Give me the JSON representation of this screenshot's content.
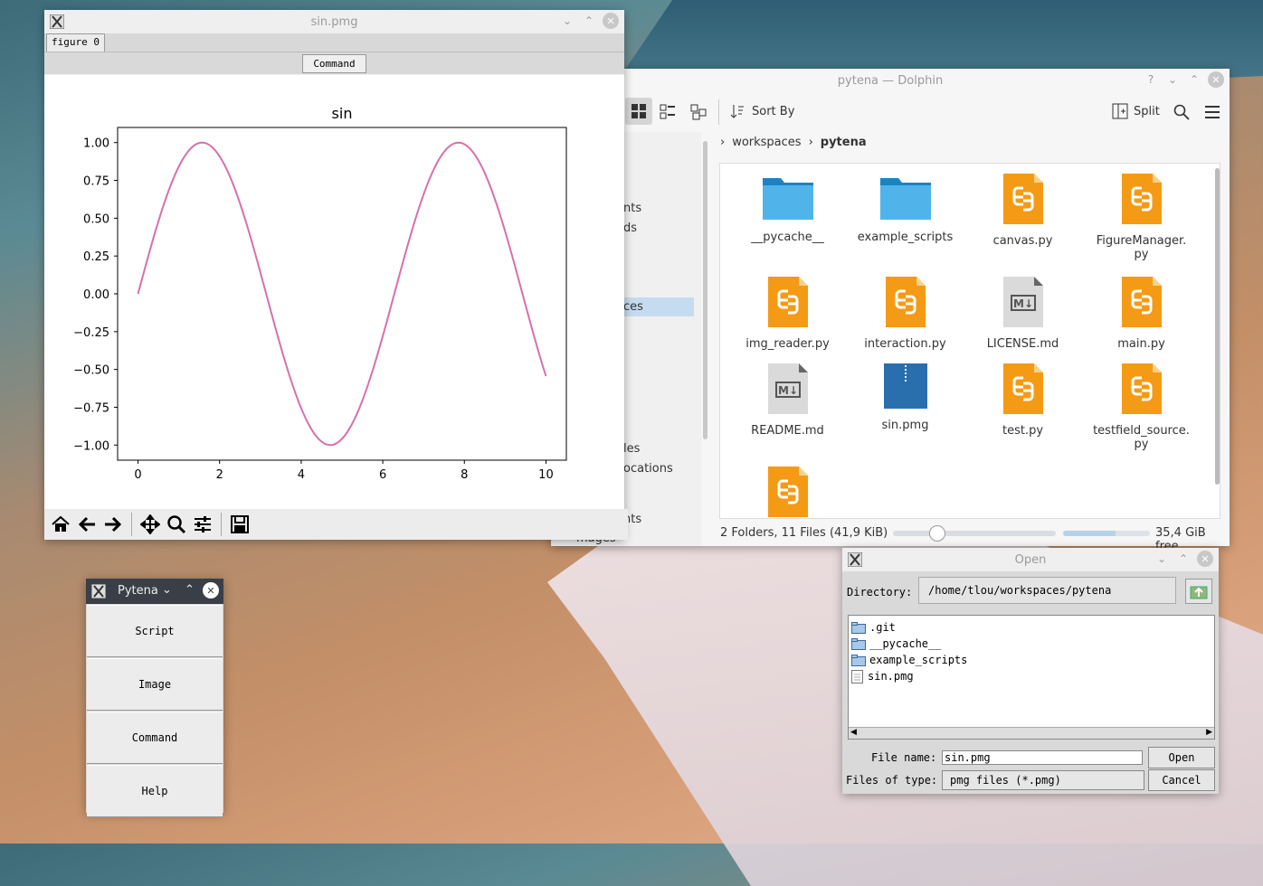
{
  "sin_window": {
    "title": "sin.pmg",
    "figure_tab": "figure 0",
    "command_button": "Command"
  },
  "chart_data": {
    "type": "line",
    "title": "sin",
    "xlabel": "",
    "ylabel": "",
    "xlim": [
      -0.5,
      10.5
    ],
    "ylim": [
      -1.1,
      1.1
    ],
    "x_ticks": [
      0,
      2,
      4,
      6,
      8,
      10
    ],
    "y_ticks": [
      1.0,
      0.75,
      0.5,
      0.25,
      0.0,
      -0.25,
      -0.5,
      -0.75,
      -1.0
    ],
    "x_tick_labels": [
      "0",
      "2",
      "4",
      "6",
      "8",
      "10"
    ],
    "y_tick_labels": [
      "1.00",
      "0.75",
      "0.50",
      "0.25",
      "0.00",
      "−0.25",
      "−0.50",
      "−0.75",
      "−1.00"
    ],
    "series": [
      {
        "function": "sin(x)",
        "x_range": [
          0,
          10
        ],
        "color": "#d670ad"
      }
    ],
    "grid": false
  },
  "dolphin": {
    "title": "pytena — Dolphin",
    "sort_label": "Sort By",
    "split_label": "Split",
    "breadcrumb": [
      "workspaces",
      "pytena"
    ],
    "sidebar_fragments": [
      "nts",
      "ds",
      "ces",
      "les",
      "ocations",
      "nts",
      "mages"
    ],
    "files": [
      {
        "name": "__pycache__",
        "kind": "folder"
      },
      {
        "name": "example_scripts",
        "kind": "folder"
      },
      {
        "name": "canvas.py",
        "kind": "python"
      },
      {
        "name": "FigureManager.\npy",
        "kind": "python"
      },
      {
        "name": "img_reader.py",
        "kind": "python"
      },
      {
        "name": "interaction.py",
        "kind": "python"
      },
      {
        "name": "LICENSE.md",
        "kind": "markdown"
      },
      {
        "name": "main.py",
        "kind": "python"
      },
      {
        "name": "README.md",
        "kind": "markdown"
      },
      {
        "name": "sin.pmg",
        "kind": "archive"
      },
      {
        "name": "test.py",
        "kind": "python"
      },
      {
        "name": "testfield_source.\npy",
        "kind": "python"
      },
      {
        "name": "",
        "kind": "python"
      }
    ],
    "status": "2 Folders, 11 Files (41,9 KiB)",
    "free_space": "35,4 GiB free"
  },
  "pytena": {
    "title": "Pytena",
    "buttons": [
      "Script",
      "Image",
      "Command",
      "Help"
    ]
  },
  "open_dialog": {
    "title": "Open",
    "directory_label": "Directory:",
    "directory": "/home/tlou/workspaces/pytena",
    "entries": [
      {
        "name": ".git",
        "kind": "folder"
      },
      {
        "name": "__pycache__",
        "kind": "folder"
      },
      {
        "name": "example_scripts",
        "kind": "folder"
      },
      {
        "name": "sin.pmg",
        "kind": "file"
      }
    ],
    "file_name_label": "File name:",
    "file_name": "sin.pmg",
    "files_of_type_label": "Files of type:",
    "files_of_type": "pmg files (*.pmg)",
    "open_button": "Open",
    "cancel_button": "Cancel"
  }
}
